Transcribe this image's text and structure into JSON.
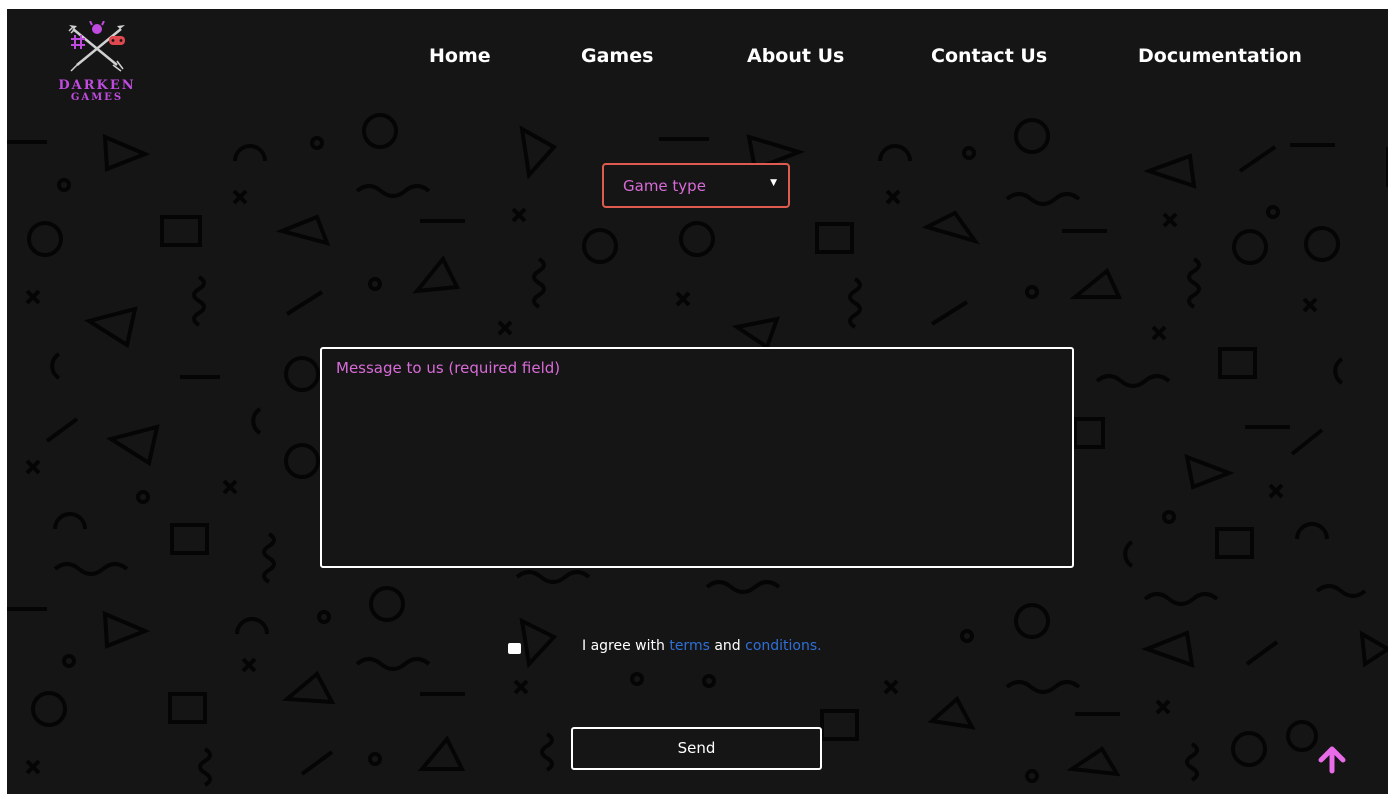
{
  "brand": {
    "title": "DARKEN",
    "subtitle": "GAMES",
    "accent_color": "#c14be0",
    "icon": "crossed-arrows-gamepad-logo-icon"
  },
  "nav": {
    "items": [
      {
        "label": "Home"
      },
      {
        "label": "Games"
      },
      {
        "label": "About Us"
      },
      {
        "label": "Contact Us"
      },
      {
        "label": "Documentation"
      }
    ]
  },
  "form": {
    "game_type": {
      "value": "Game type",
      "icon": "caret-down-icon",
      "border_color": "#e05b4f"
    },
    "message": {
      "placeholder": "Message to us (required field)"
    },
    "agree": {
      "text_before": "I agree with",
      "terms_label": "terms",
      "conjunction": "and",
      "conditions_label": "conditions.",
      "link_color": "#2f6fd8"
    },
    "send_label": "Send"
  },
  "scroll_top": {
    "icon": "arrow-up-icon",
    "color": "#e86be8"
  },
  "theme": {
    "background": "#151515",
    "placeholder_color": "#d86bd8"
  }
}
